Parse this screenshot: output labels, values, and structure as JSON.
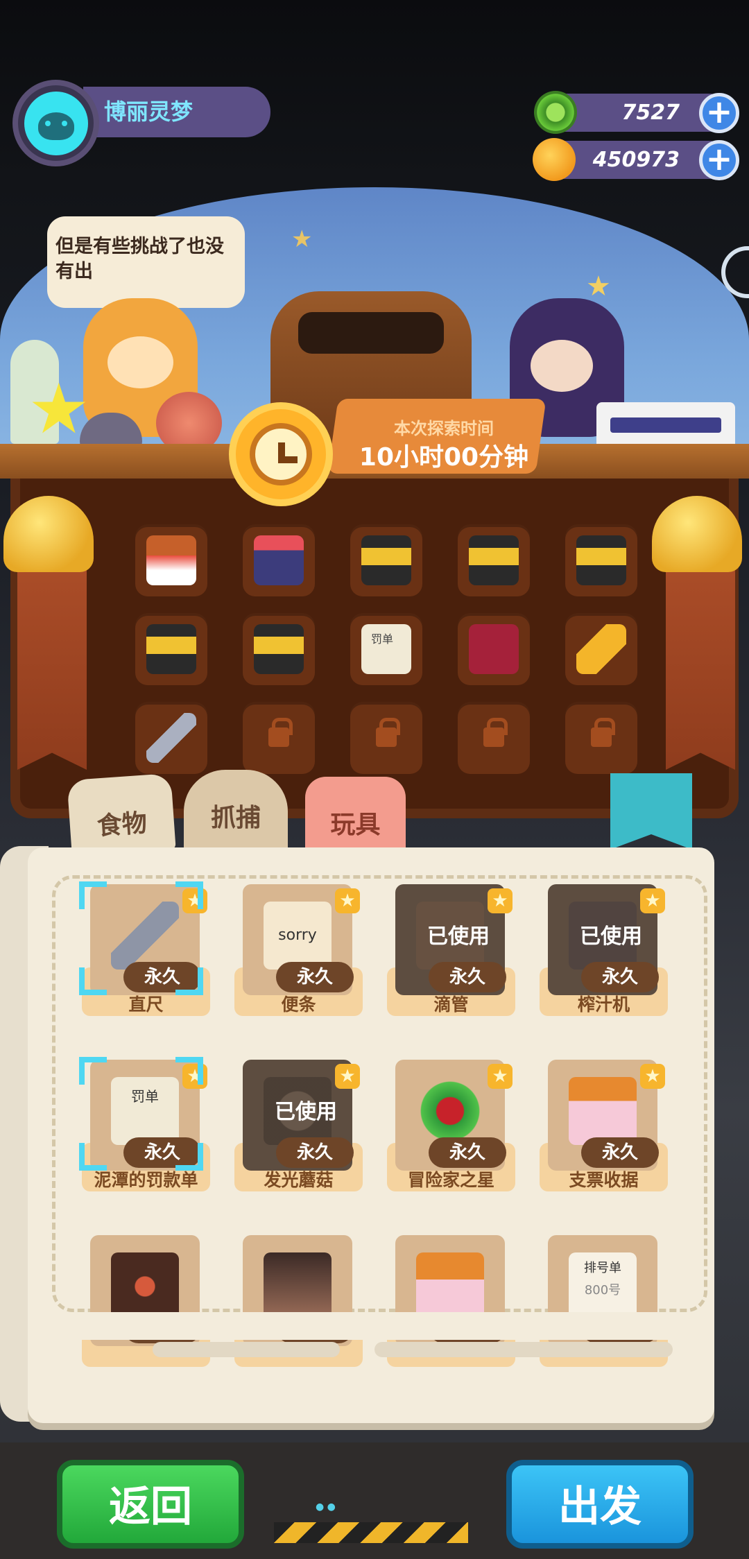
{
  "player": {
    "name": "博丽灵梦"
  },
  "currency": {
    "gems": "7527",
    "coins": "450973",
    "plus_symbol": "+"
  },
  "scene": {
    "speech": "但是有些挑战了也没有出",
    "time_label": "本次探索时间",
    "time_value": "10小时00分钟"
  },
  "backpack_slots": [
    {
      "icon": "fried-chicken-bucket-icon"
    },
    {
      "icon": "bento-box-icon"
    },
    {
      "icon": "toolbox-icon"
    },
    {
      "icon": "toolbox-icon"
    },
    {
      "icon": "toolbox-icon"
    },
    {
      "icon": "toolbox-icon"
    },
    {
      "icon": "toolbox-icon"
    },
    {
      "icon": "ticket-document-icon"
    },
    {
      "icon": "red-pouch-icon"
    },
    {
      "icon": "flashlight-icon"
    },
    {
      "icon": "ruler-icon"
    },
    {
      "icon": "lock-icon"
    },
    {
      "icon": "lock-icon"
    },
    {
      "icon": "lock-icon"
    },
    {
      "icon": "lock-icon"
    }
  ],
  "tabs": {
    "food": "食物",
    "capture": "抓捕",
    "toy": "玩具"
  },
  "inventory": {
    "forever": "永久",
    "used": "已使用",
    "star_symbol": "★",
    "items": [
      {
        "name": "直尺",
        "icon": "ruler-icon",
        "used": false,
        "selected": true
      },
      {
        "name": "便条",
        "icon": "sorry-note-icon",
        "used": false,
        "selected": false
      },
      {
        "name": "滴管",
        "icon": "dropper-icon",
        "used": true,
        "selected": false
      },
      {
        "name": "榨汁机",
        "icon": "juicer-icon",
        "used": true,
        "selected": false
      },
      {
        "name": "泥潭的罚款单",
        "icon": "fine-ticket-icon",
        "used": false,
        "selected": true
      },
      {
        "name": "发光蘑菇",
        "icon": "glowing-mushroom-icon",
        "used": true,
        "selected": false
      },
      {
        "name": "冒险家之星",
        "icon": "adventurer-star-icon",
        "used": false,
        "selected": false
      },
      {
        "name": "支票收据",
        "icon": "check-receipt-icon",
        "used": false,
        "selected": false
      },
      {
        "name": "",
        "icon": "forbidden-box-icon",
        "used": false,
        "selected": false
      },
      {
        "name": "",
        "icon": "portrait-card-icon",
        "used": false,
        "selected": false
      },
      {
        "name": "",
        "icon": "envelope-icon",
        "used": false,
        "selected": false
      },
      {
        "name": "",
        "icon": "queue-ticket-icon",
        "used": false,
        "selected": false
      }
    ]
  },
  "queue_ticket": {
    "title": "排号单",
    "number": "800号"
  },
  "ticket_word": "罚单",
  "note_word": "sorry",
  "buttons": {
    "back": "返回",
    "depart": "出发"
  },
  "colors": {
    "accent_blue": "#3f87e6",
    "back_green": "#2fbf4a",
    "depart_blue": "#1aa8e8"
  }
}
